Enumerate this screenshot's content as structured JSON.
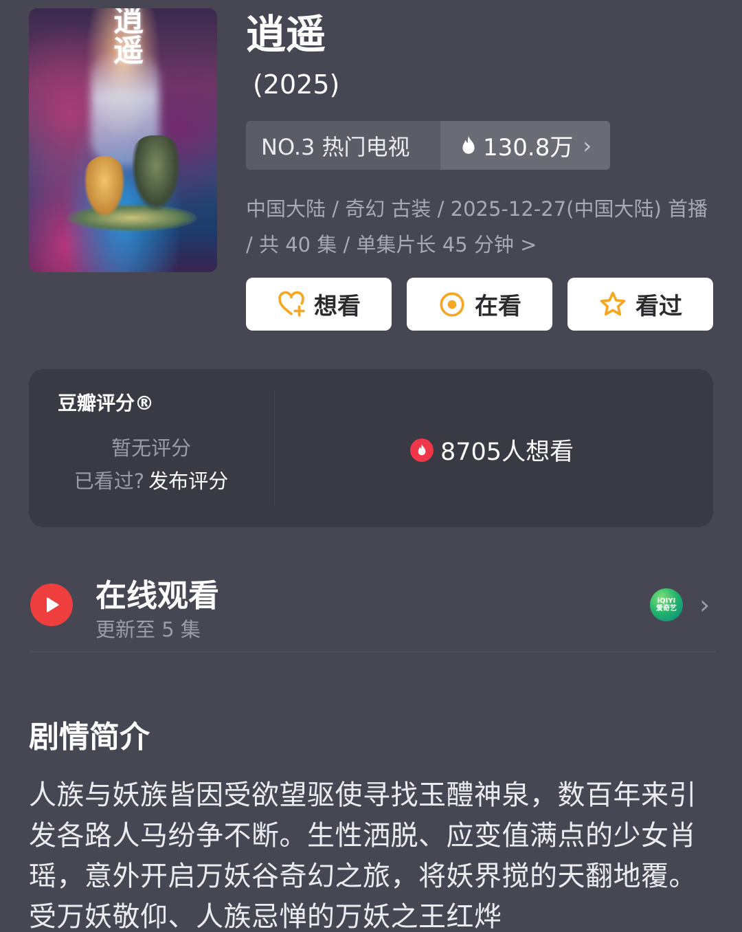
{
  "poster": {
    "calligraphy": "逍遥"
  },
  "title": "逍遥",
  "year": "(2025)",
  "rank": {
    "label": "NO.3 热门电视",
    "heat": "130.8万"
  },
  "meta": {
    "text": "中国大陆 / 奇幻 古装 / 2025-12-27(中国大陆) 首播 / 共 40 集 / 单集片长 45 分钟",
    "chevron": ">"
  },
  "actions": [
    {
      "label": "想看",
      "icon": "heart-plus-icon"
    },
    {
      "label": "在看",
      "icon": "watching-circle-icon"
    },
    {
      "label": "看过",
      "icon": "star-icon"
    }
  ],
  "rating": {
    "label": "豆瓣评分®",
    "status": "暂无评分",
    "prompt": "已看过?",
    "link": "发布评分",
    "want_count": "8705人想看"
  },
  "watch": {
    "title": "在线观看",
    "subtitle": "更新至 5 集",
    "provider_top": "iQIYI",
    "provider_bottom": "爱奇艺"
  },
  "synopsis": {
    "title": "剧情简介",
    "body": "人族与妖族皆因受欲望驱使寻找玉醴神泉，数百年来引发各路人马纷争不断。生性洒脱、应变值满点的少女肖瑶，意外开启万妖谷奇幻之旅，将妖界搅的天翻地覆。受万妖敬仰、人族忌惮的万妖之王红烨"
  },
  "colors": {
    "background": "#474753",
    "card": "#3a3a44",
    "accent_red": "#ef3e3e",
    "button_icon_orange": "#f5a623"
  }
}
